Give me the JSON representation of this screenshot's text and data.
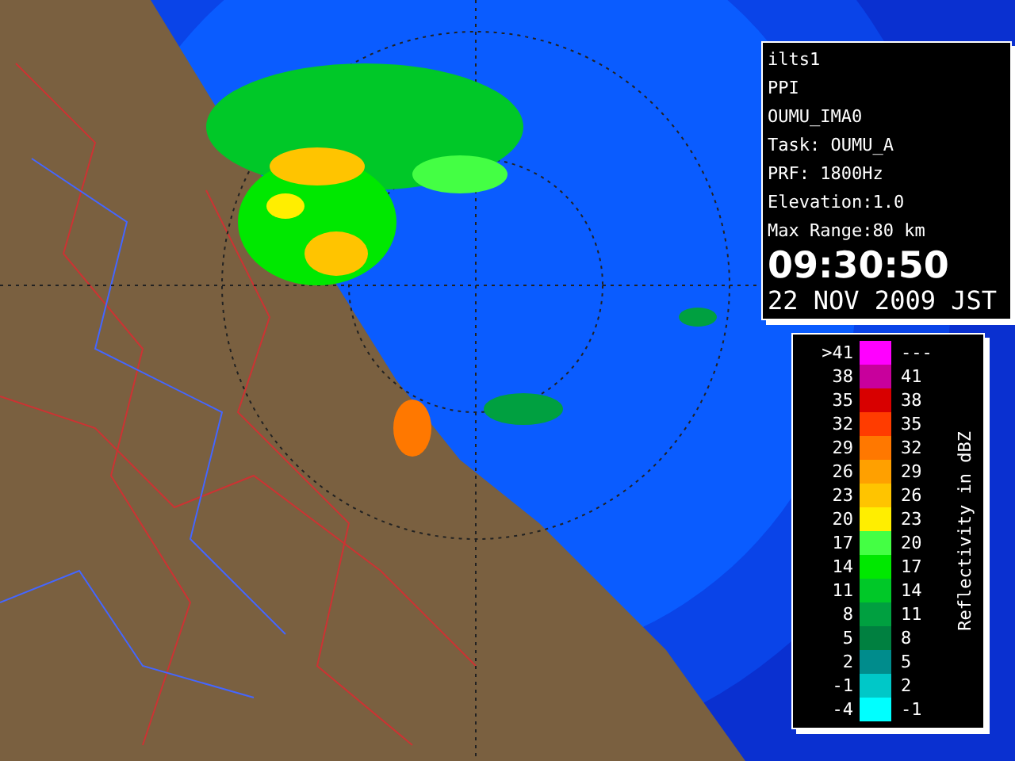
{
  "info_panel": {
    "lines": [
      "ilts1",
      "PPI",
      "OUMU_IMA0",
      "Task: OUMU_A",
      "PRF: 1800Hz",
      "Elevation:1.0",
      "Max Range:80 km"
    ],
    "time": "09:30:50",
    "date": "22 NOV 2009 JST"
  },
  "legend": {
    "title": "Reflectivity in dBZ",
    "rows": [
      {
        "low": ">41",
        "high": "---",
        "color": "#ff00ff"
      },
      {
        "low": "38",
        "high": "41",
        "color": "#c8009c"
      },
      {
        "low": "35",
        "high": "38",
        "color": "#d80000"
      },
      {
        "low": "32",
        "high": "35",
        "color": "#ff3c00"
      },
      {
        "low": "29",
        "high": "32",
        "color": "#ff7800"
      },
      {
        "low": "26",
        "high": "29",
        "color": "#ffa000"
      },
      {
        "low": "23",
        "high": "26",
        "color": "#ffc400"
      },
      {
        "low": "20",
        "high": "23",
        "color": "#ffee00"
      },
      {
        "low": "17",
        "high": "20",
        "color": "#44ff44"
      },
      {
        "low": "14",
        "high": "17",
        "color": "#00e800"
      },
      {
        "low": "11",
        "high": "14",
        "color": "#00c828"
      },
      {
        "low": "8",
        "high": "11",
        "color": "#00a040"
      },
      {
        "low": "5",
        "high": "8",
        "color": "#008040"
      },
      {
        "low": "2",
        "high": "5",
        "color": "#008c8c"
      },
      {
        "low": "-1",
        "high": "2",
        "color": "#00c8c8"
      },
      {
        "low": "-4",
        "high": "-1",
        "color": "#00ffff"
      }
    ]
  }
}
